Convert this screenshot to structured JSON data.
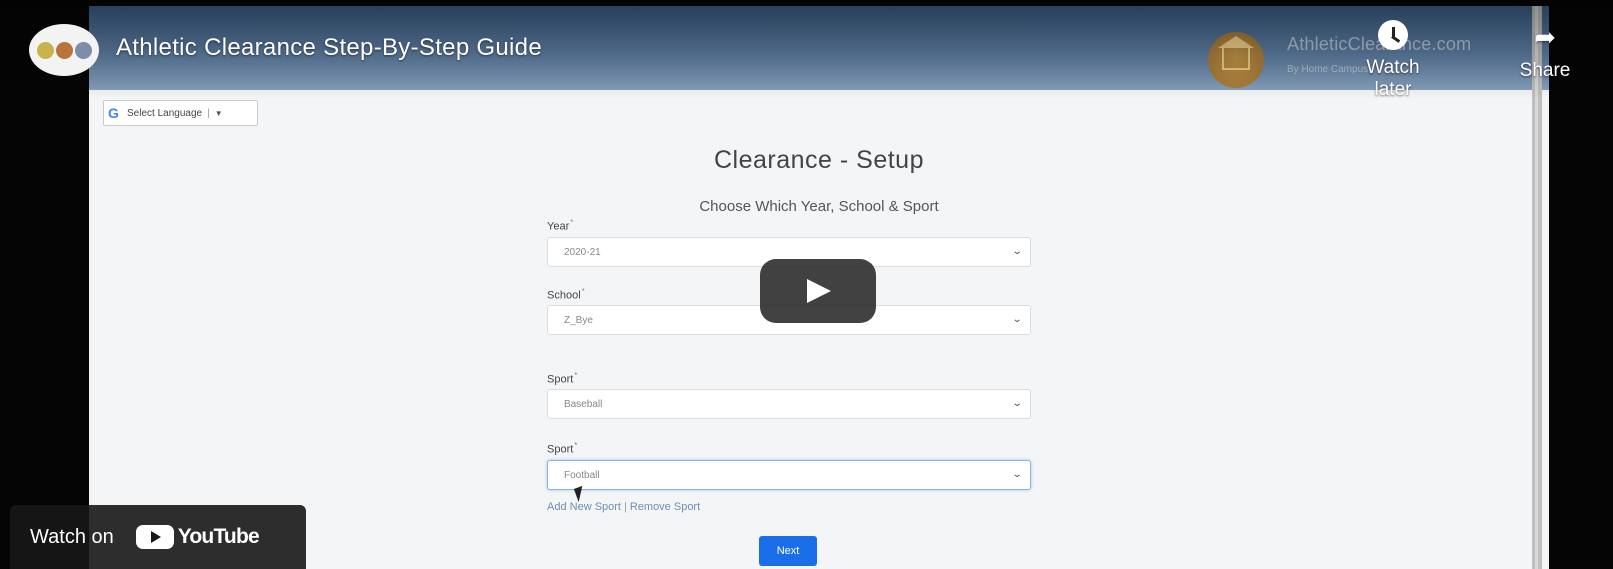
{
  "video": {
    "title": "Athletic Clearance Step-By-Step Guide",
    "watch_later_label": "Watch later",
    "share_label": "Share",
    "watch_on_label": "Watch on",
    "youtube_label": "YouTube"
  },
  "site": {
    "name": "AthleticClearance.com",
    "byline": "By Home Campus",
    "translate_label": "Select Language",
    "translate_separator": "|",
    "translate_arrow": "▼"
  },
  "form": {
    "title": "Clearance - Setup",
    "subtitle": "Choose Which Year, School & Sport",
    "required_marker": "*",
    "fields": [
      {
        "label": "Year",
        "value": "2020-21"
      },
      {
        "label": "School",
        "value": "Z_Bye"
      },
      {
        "label": "Sport",
        "value": "Baseball"
      },
      {
        "label": "Sport",
        "value": "Football"
      }
    ],
    "add_sport_label": "Add New Sport",
    "links_separator": "|",
    "remove_sport_label": "Remove Sport",
    "next_label": "Next"
  },
  "icons": {
    "chevron": "⌄",
    "share": "➦",
    "google": "G"
  },
  "colors": {
    "banner_top": "#3c5f86",
    "next_button": "#1a6fe8",
    "link": "#6f8fb3",
    "logo_orange": "#c4892e"
  }
}
